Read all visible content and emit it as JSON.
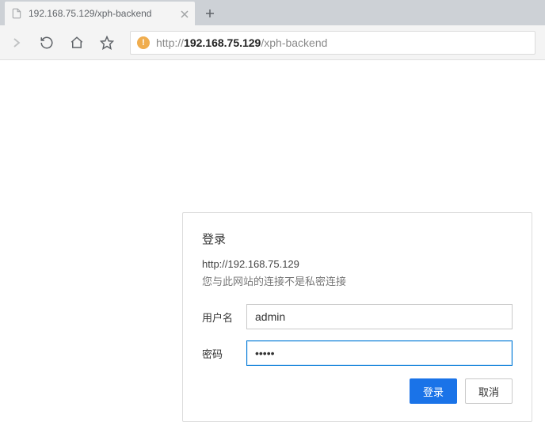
{
  "tab": {
    "title": "192.168.75.129/xph-backend"
  },
  "url": {
    "protocol": "http://",
    "host": "192.168.75.129",
    "path": "/xph-backend"
  },
  "dialog": {
    "title": "登录",
    "origin": "http://192.168.75.129",
    "warning": "您与此网站的连接不是私密连接",
    "username_label": "用户名",
    "password_label": "密码",
    "username_value": "admin",
    "password_value": "•••••",
    "login_button": "登录",
    "cancel_button": "取消"
  }
}
